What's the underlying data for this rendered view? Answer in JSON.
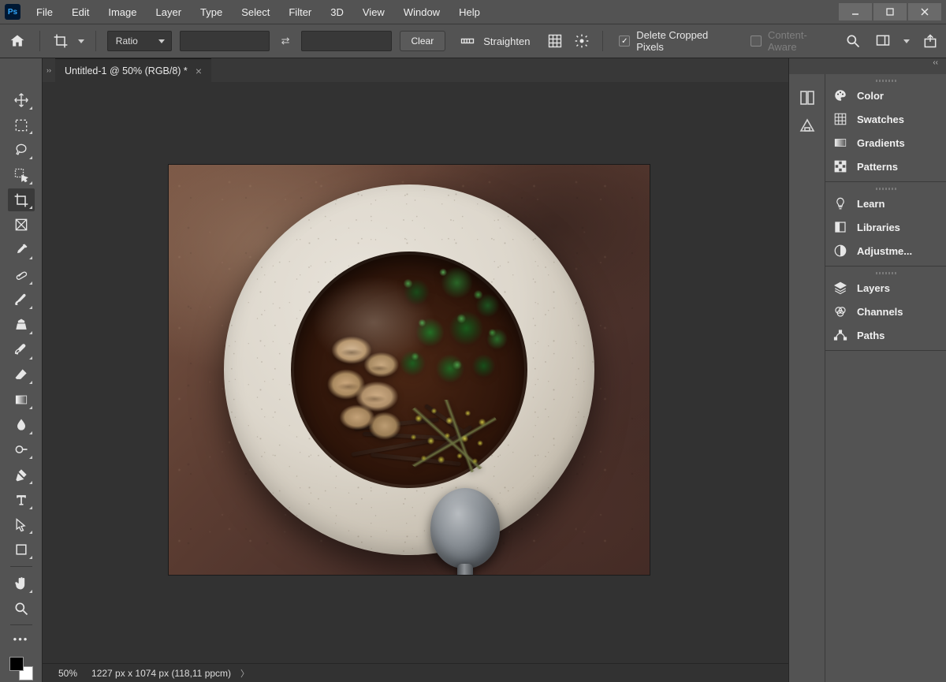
{
  "app": {
    "logo": "Ps"
  },
  "menu": [
    "File",
    "Edit",
    "Image",
    "Layer",
    "Type",
    "Select",
    "Filter",
    "3D",
    "View",
    "Window",
    "Help"
  ],
  "options": {
    "ratio_mode": "Ratio",
    "clear_label": "Clear",
    "straighten_label": "Straighten",
    "delete_cropped_label": "Delete Cropped Pixels",
    "delete_cropped_checked": true,
    "content_aware_label": "Content-Aware",
    "content_aware_checked": false
  },
  "tab": {
    "title": "Untitled-1 @ 50% (RGB/8) *"
  },
  "status": {
    "zoom": "50%",
    "dims": "1227 px x 1074 px (118,11 ppcm)"
  },
  "panels": {
    "group1": [
      "Color",
      "Swatches",
      "Gradients",
      "Patterns"
    ],
    "group2": [
      "Learn",
      "Libraries",
      "Adjustme..."
    ],
    "group3": [
      "Layers",
      "Channels",
      "Paths"
    ]
  }
}
